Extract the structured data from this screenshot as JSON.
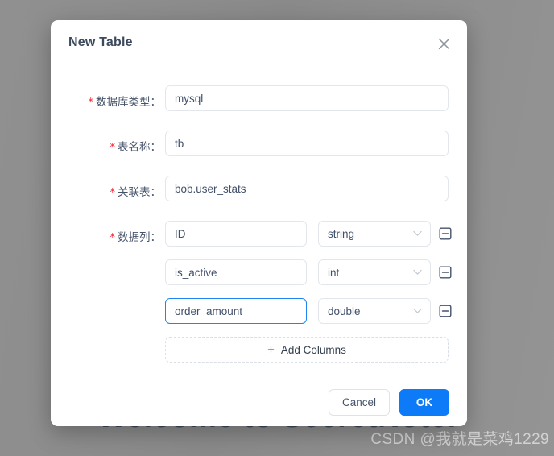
{
  "background": {
    "hero_text": "Welcome to SecretNote.",
    "watermark": "CSDN @我就是菜鸡1229",
    "hero_color": "#3d4a5c",
    "overlay_color": "#8c8c8c"
  },
  "dialog": {
    "title": "New Table",
    "close_icon": "close-icon",
    "fields": [
      {
        "label": "数据库类型：",
        "required": true,
        "value": "mysql"
      },
      {
        "label": "表名称：",
        "required": true,
        "value": "tb"
      },
      {
        "label": "关联表：",
        "required": true,
        "value": "bob.user_stats"
      }
    ],
    "columns_label": "数据列：",
    "columns_required": true,
    "columns": [
      {
        "name": "ID",
        "type": "string",
        "focused": false,
        "remove_icon": "minus-square-icon"
      },
      {
        "name": "is_active",
        "type": "int",
        "focused": false,
        "remove_icon": "minus-square-icon"
      },
      {
        "name": "order_amount",
        "type": "double",
        "focused": true,
        "remove_icon": "minus-square-icon"
      }
    ],
    "add_columns": {
      "label": "Add Columns",
      "plus_glyph": "+"
    },
    "footer": {
      "cancel_label": "Cancel",
      "ok_label": "OK",
      "ok_color": "#0d7bf7"
    },
    "accent_focus_color": "#1f84f0",
    "required_star_color": "#f5222d"
  }
}
